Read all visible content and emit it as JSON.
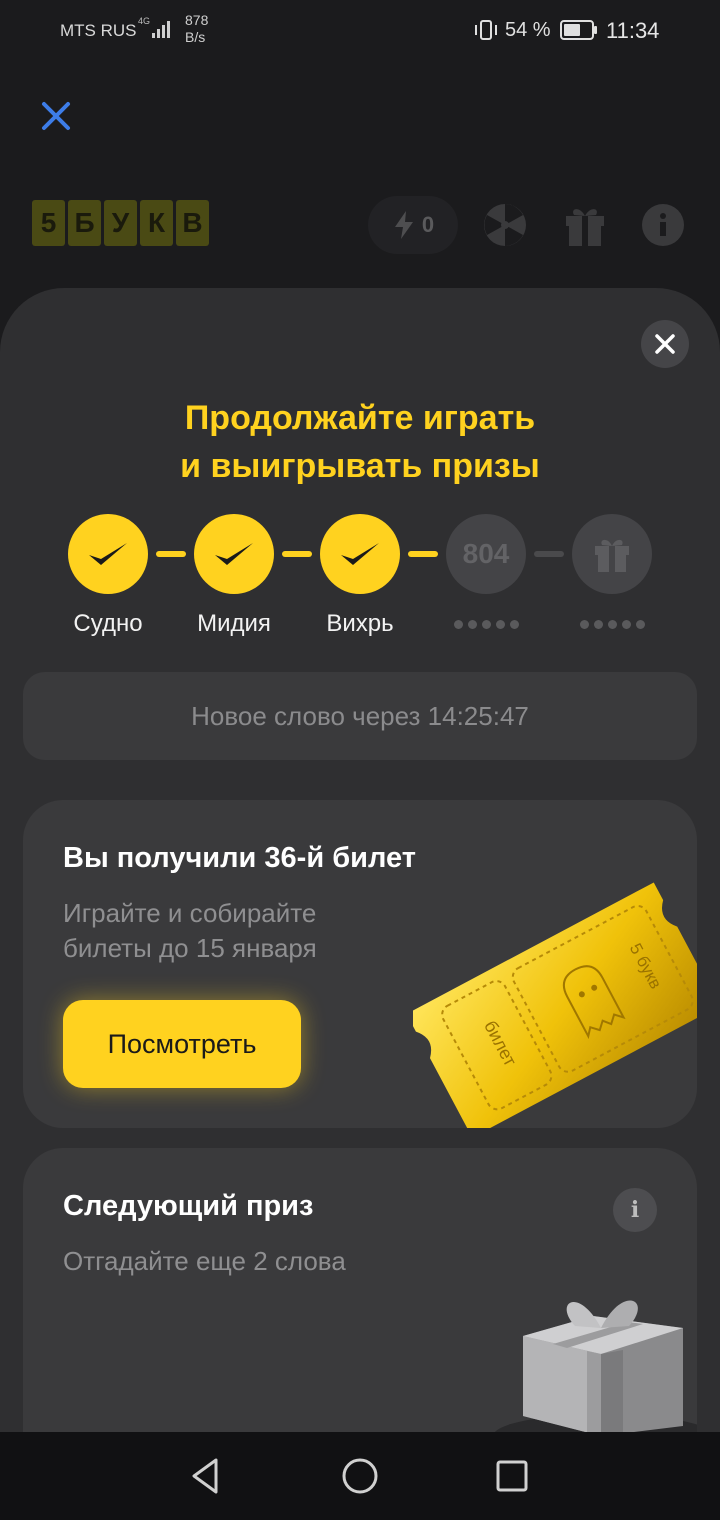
{
  "status_bar": {
    "carrier": "MTS RUS",
    "network": "4G",
    "speed_value": "878",
    "speed_unit": "B/s",
    "battery": "54 %",
    "time": "11:34"
  },
  "header": {
    "logo_letters": [
      "5",
      "Б",
      "У",
      "К",
      "В"
    ],
    "energy_count": "0"
  },
  "sheet": {
    "title_line1": "Продолжайте играть",
    "title_line2": "и выигрывать призы",
    "steps": [
      {
        "label": "Судно",
        "state": "done"
      },
      {
        "label": "Мидия",
        "state": "done"
      },
      {
        "label": "Вихрь",
        "state": "done"
      },
      {
        "label": "804",
        "state": "pending"
      },
      {
        "label": "",
        "state": "gift"
      }
    ],
    "timer_text": "Новое слово через 14:25:47",
    "ticket_card": {
      "title": "Вы получили 36-й билет",
      "subtitle_line1": "Играйте и собирайте",
      "subtitle_line2": "билеты до 15 января",
      "button_label": "Посмотреть",
      "ticket_label_brand": "5 букв",
      "ticket_label_word": "билет"
    },
    "prize_card": {
      "title": "Следующий приз",
      "subtitle": "Отгадайте еще 2 слова",
      "info_label": "i"
    }
  },
  "colors": {
    "accent": "#ffd21f",
    "sheet_bg": "#2f2f31",
    "card_bg": "#3a3a3c",
    "muted_text": "#8f8f91"
  }
}
